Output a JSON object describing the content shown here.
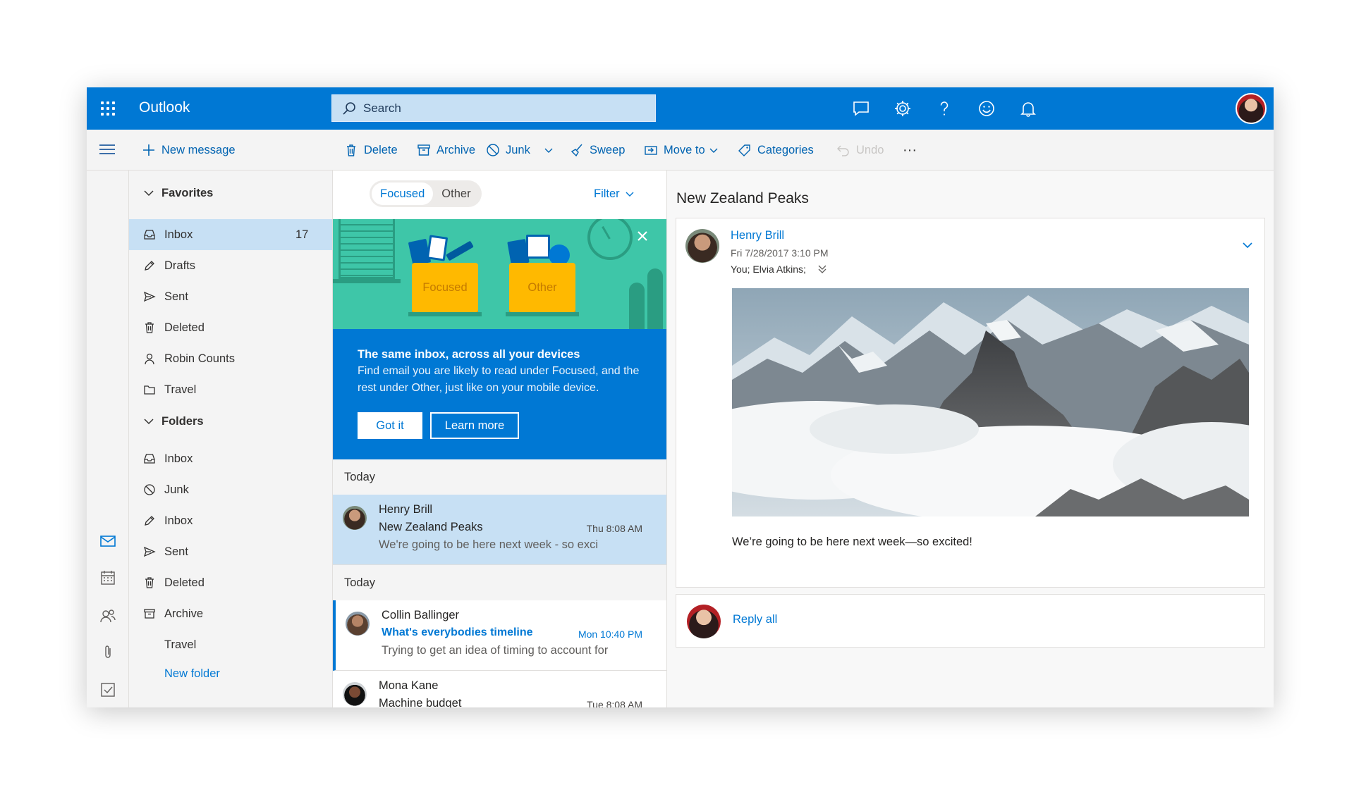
{
  "app": {
    "title": "Outlook"
  },
  "search": {
    "placeholder": "Search"
  },
  "topbar_icons": [
    "chat-icon",
    "gear-icon",
    "help-icon",
    "smiley-icon",
    "bell-icon"
  ],
  "commands": {
    "new_message": "New message",
    "delete": "Delete",
    "archive": "Archive",
    "junk": "Junk",
    "sweep": "Sweep",
    "move_to": "Move to",
    "categories": "Categories",
    "undo": "Undo"
  },
  "favorites": {
    "label": "Favorites",
    "items": [
      {
        "label": "Inbox",
        "count": "17",
        "selected": true
      },
      {
        "label": "Drafts"
      },
      {
        "label": "Sent"
      },
      {
        "label": "Deleted"
      },
      {
        "label": "Robin Counts"
      },
      {
        "label": "Travel"
      }
    ]
  },
  "folders": {
    "label": "Folders",
    "items": [
      {
        "label": "Inbox"
      },
      {
        "label": "Junk"
      },
      {
        "label": "Inbox"
      },
      {
        "label": "Sent"
      },
      {
        "label": "Deleted"
      },
      {
        "label": "Archive"
      },
      {
        "label": "Travel"
      }
    ],
    "new_folder": "New folder"
  },
  "list": {
    "tabs": [
      {
        "label": "Focused",
        "active": true
      },
      {
        "label": "Other"
      }
    ],
    "filter": "Filter",
    "banner": {
      "box_focused": "Focused",
      "box_other": "Other",
      "title": "The same inbox, across all your devices",
      "body": "Find email you are likely to read under Focused, and the rest under Other, just like on your mobile device.",
      "got_it": "Got it",
      "learn_more": "Learn more"
    },
    "groups": [
      {
        "label": "Today",
        "messages": [
          {
            "from": "Henry Brill",
            "subject": "New Zealand Peaks",
            "time": "Thu 8:08 AM",
            "preview": "We're going to be here next week - so exci",
            "selected": true
          }
        ]
      },
      {
        "label": "Today",
        "messages": [
          {
            "from": "Collin Ballinger",
            "subject": "What's everybodies timeline",
            "time": "Mon 10:40 PM",
            "preview": "Trying to get an idea of timing to account for",
            "unread": true
          },
          {
            "from": "Mona Kane",
            "subject": "Machine budget",
            "time": "Tue 8:08 AM",
            "preview": ""
          }
        ]
      }
    ]
  },
  "reading": {
    "subject": "New Zealand Peaks",
    "sender": "Henry Brill",
    "date": "Fri 7/28/2017 3:10 PM",
    "recipients": "You; Elvia Atkins;",
    "body": "We’re going to be here next week—so excited!",
    "reply_all": "Reply all"
  },
  "colors": {
    "brand": "#0078d4",
    "selected": "#c7e0f4",
    "banner_green": "#3ec6a8",
    "box_yellow": "#ffb900"
  }
}
